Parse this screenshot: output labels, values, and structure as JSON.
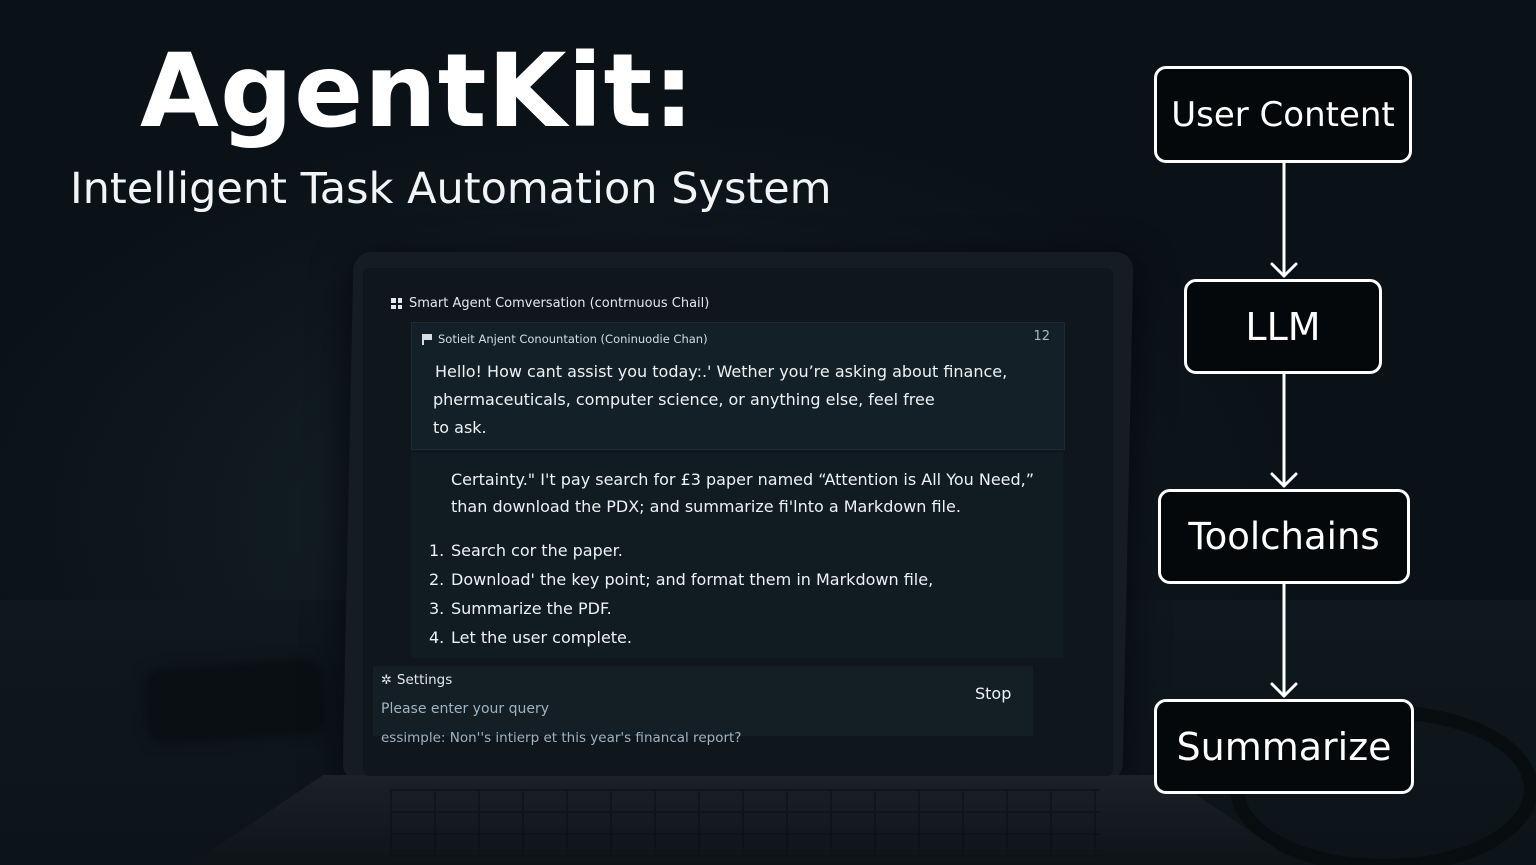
{
  "title": "AgentKit:",
  "subtitle": "Intelligent Task Automation System",
  "window": {
    "title": "Smart Agent Comversation (contrnuous Chail)",
    "chat_header": "Sotieit Anjent Conountation (Coninuodie Chan)",
    "count": "12"
  },
  "messages": {
    "greeting_lines": [
      "Hello! How cant assist you today:.' Wether you’re asking about finance,",
      "phermaceuticals, computer science, or anything else, feel free",
      "to ask."
    ],
    "reply_lines": [
      "Certainty.\" I't pay search for £3 paper named “Attention is All You Need,”",
      "than download the PDX; and summarize fi'lnto a Markdown file."
    ],
    "steps": [
      {
        "num": "1.",
        "text": "Search cor the paper."
      },
      {
        "num": "2.",
        "text": "Download' the key point; and format them in Markdown file,"
      },
      {
        "num": "3.",
        "text": "Summarize the PDF."
      },
      {
        "num": "4.",
        "text": "Let the user complete."
      }
    ]
  },
  "footer": {
    "settings_label": "Settings",
    "stop_label": "Stop",
    "query_placeholder": "Please enter your query",
    "example_text": "essimple: Non''s intierp et this year's financal report?"
  },
  "flow": {
    "nodes": [
      "User Content",
      "LLM",
      "Toolchains",
      "Summarize"
    ]
  },
  "colors": {
    "background": "#0b1218",
    "text": "#ffffff",
    "node_border": "#ffffff",
    "muted_text": "#9fb4c4"
  },
  "icons": {
    "window": "grid-icon",
    "chat": "flag-icon",
    "settings": "gear-icon",
    "flow_connector": "arrow-down-icon"
  }
}
